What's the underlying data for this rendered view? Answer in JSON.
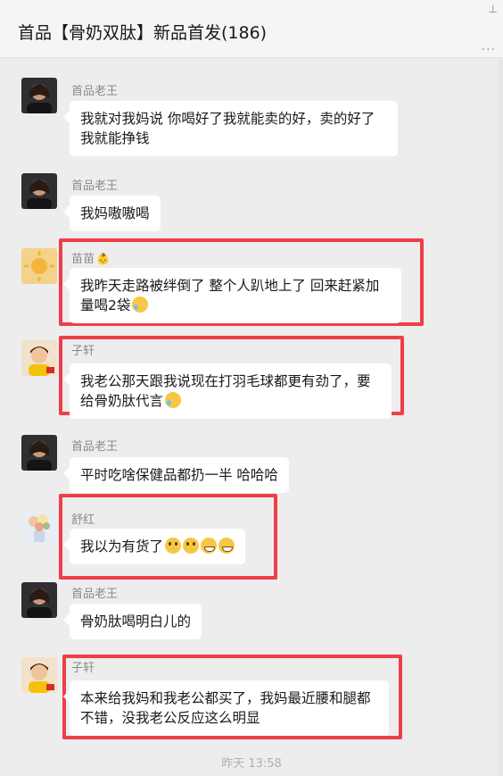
{
  "header": {
    "title": "首品【骨奶双肽】新品首发(186)",
    "pin_icon": "pin-icon",
    "more_icon": "more-icon"
  },
  "messages": [
    {
      "sender": "首品老王",
      "text": "我就对我妈说 你喝好了我就能卖的好，卖的好了我就能挣钱",
      "avatar": "avatar-woman-dark"
    },
    {
      "sender": "首品老王",
      "text": "我妈嗷嗷喝",
      "avatar": "avatar-woman-dark"
    },
    {
      "sender": "苗苗",
      "sender_icon": "👶",
      "text": "我昨天走路被绊倒了 整个人趴地上了 回来赶紧加量喝2袋",
      "avatar": "avatar-sun"
    },
    {
      "sender": "子轩",
      "text": "我老公那天跟我说现在打羽毛球都更有劲了，要给骨奶肽代言",
      "avatar": "avatar-kid"
    },
    {
      "sender": "首品老王",
      "text": "平时吃啥保健品都扔一半 哈哈哈",
      "avatar": "avatar-woman-dark"
    },
    {
      "sender": "舒红",
      "text": "我以为有货了",
      "avatar": "avatar-flower"
    },
    {
      "sender": "首品老王",
      "text": "骨奶肽喝明白儿的",
      "avatar": "avatar-woman-dark"
    },
    {
      "sender": "子轩",
      "text": "本来给我妈和我老公都买了，我妈最近腰和腿都不错，没我老公反应这么明显",
      "avatar": "avatar-kid"
    }
  ],
  "timestamp": "昨天 13:58",
  "colors": {
    "background": "#ededed",
    "bubble": "#ffffff",
    "highlight": "#ee3e48",
    "sender_name": "#8a8a8a"
  }
}
